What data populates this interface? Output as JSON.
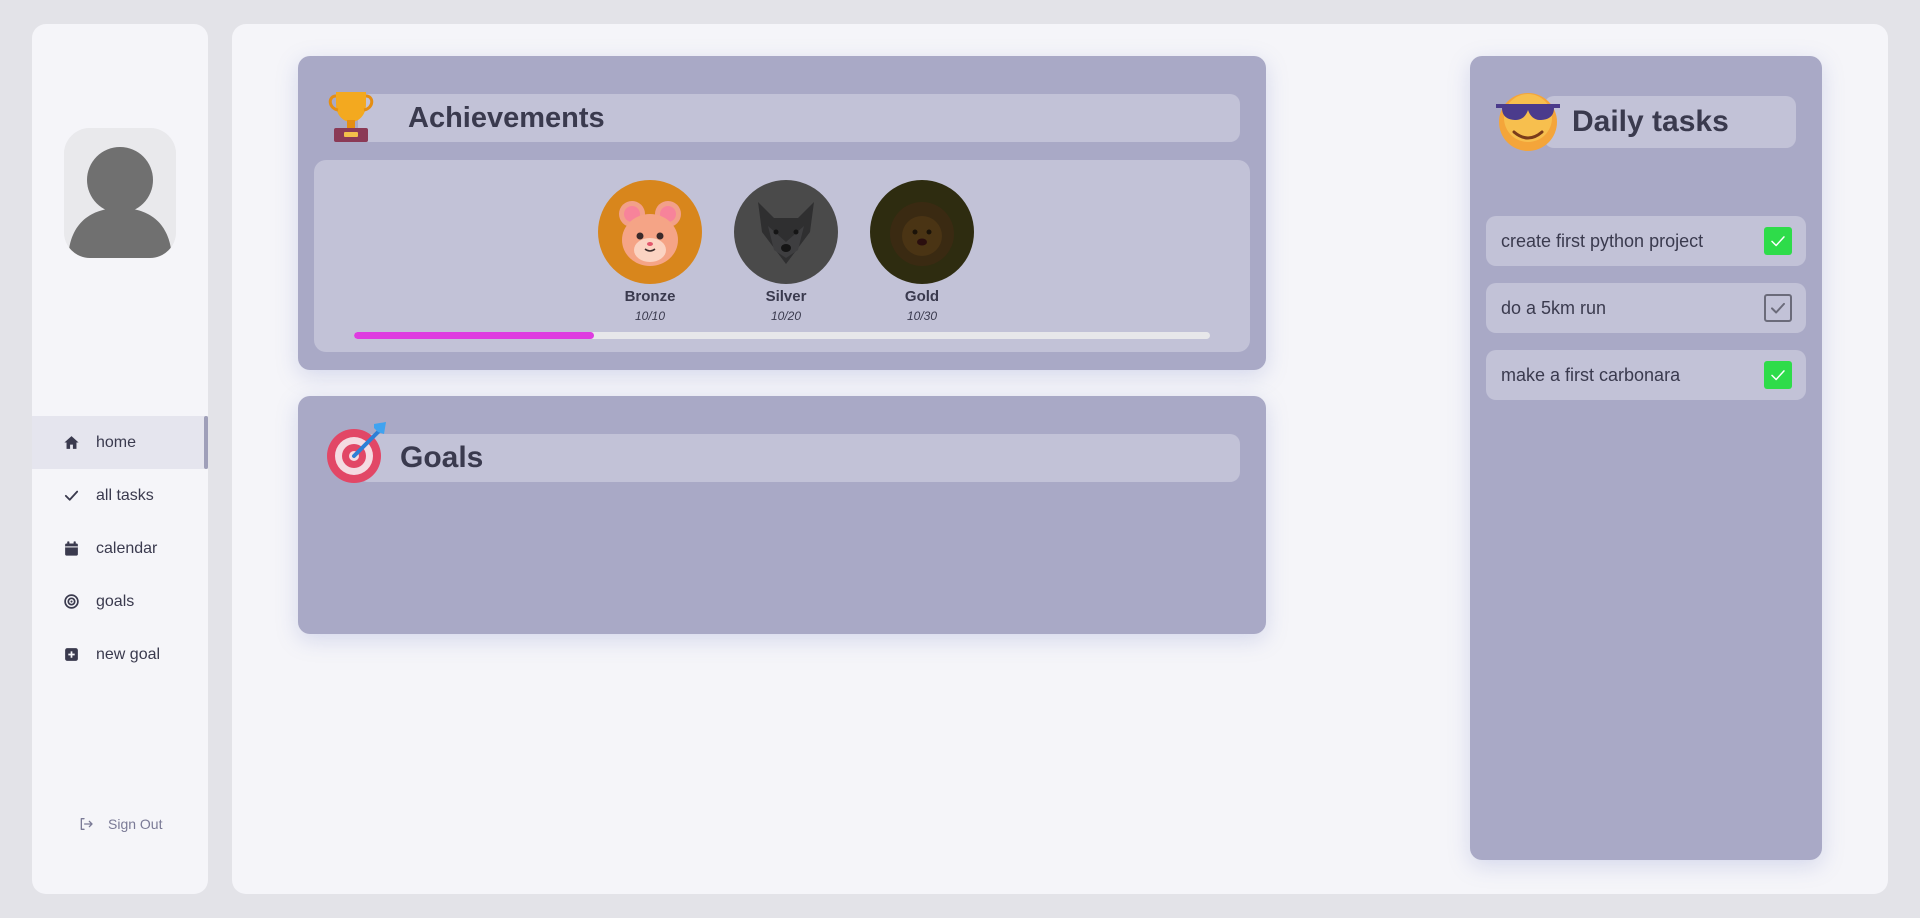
{
  "sidebar": {
    "nav": [
      {
        "label": "home",
        "icon": "home-icon"
      },
      {
        "label": "all tasks",
        "icon": "check-icon"
      },
      {
        "label": "calendar",
        "icon": "calendar-icon"
      },
      {
        "label": "goals",
        "icon": "target-icon"
      },
      {
        "label": "new goal",
        "icon": "plus-square-icon"
      }
    ],
    "active": "home",
    "signout_label": "Sign Out"
  },
  "achievements": {
    "title": "Achievements",
    "badges": [
      {
        "name": "Bronze",
        "count": "10/10",
        "color": "#d8861c"
      },
      {
        "name": "Silver",
        "count": "10/20",
        "color": "#4a4a4a"
      },
      {
        "name": "Gold",
        "count": "10/30",
        "color": "#2e2c10"
      }
    ],
    "progress_fraction": 0.28,
    "progress_color": "#de3ce0"
  },
  "goals": {
    "title": "Goals"
  },
  "daily_tasks": {
    "title": "Daily tasks",
    "items": [
      {
        "label": "create first python project",
        "checked": true
      },
      {
        "label": "do a 5km run",
        "checked": false
      },
      {
        "label": "make a first carbonara",
        "checked": true
      }
    ]
  },
  "colors": {
    "accent": "#de3ce0",
    "check_green": "#2edc4a",
    "card_bg": "#a9a9c6"
  }
}
